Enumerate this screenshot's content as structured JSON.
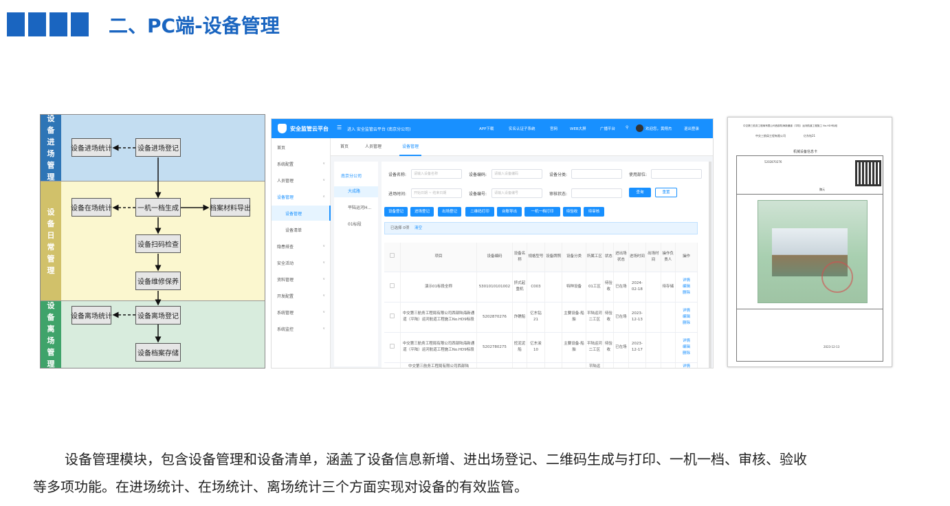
{
  "header": {
    "title": "二、PC端-设备管理",
    "accent": "#1a65c0"
  },
  "flow": {
    "bands": [
      {
        "label": "设备进场管理",
        "color": "#c3ddf1",
        "label_color": "#2e75b6"
      },
      {
        "label": "设备日常管理",
        "color": "#fbf7cf",
        "label_color": "#d1c16a"
      },
      {
        "label": "设备离场管理",
        "color": "#d8ecdd",
        "label_color": "#3fa36a"
      }
    ],
    "boxes": {
      "entry_stats": "设备进场统计",
      "entry_register": "设备进场登记",
      "onsite_stats": "设备在场统计",
      "one_machine": "一机一档生成",
      "archive_export": "档案材料导出",
      "scan_check": "设备扫码检查",
      "maintenance": "设备维修保养",
      "exit_stats": "设备离场统计",
      "exit_register": "设备离场登记",
      "archive_store": "设备档案存储"
    }
  },
  "app": {
    "brand": "安全监管云平台",
    "enter": "进入 安全监管云平台 (南京分公司)",
    "top_links": [
      "APP下载",
      "实名认证子系统",
      "官网",
      "WEB大屏",
      "广播平台"
    ],
    "user": "欢迎您，黄翔杰",
    "logout": "退出登录",
    "sidebar": [
      {
        "label": "首页"
      },
      {
        "label": "系统配置"
      },
      {
        "label": "人员管理"
      },
      {
        "label": "设备管理"
      },
      {
        "label": "设备管理"
      },
      {
        "label": "设备清单"
      },
      {
        "label": "隐患排查"
      },
      {
        "label": "安全活动"
      },
      {
        "label": "资料管理"
      },
      {
        "label": "开发配置"
      },
      {
        "label": "系统管理"
      },
      {
        "label": "系统监控"
      }
    ],
    "tabs": [
      "首页",
      "人员管理",
      "设备管理"
    ],
    "tree": [
      "南京分公司",
      "大成路",
      "平陆运河H...",
      "01标段"
    ],
    "filters": {
      "name_label": "设备名称:",
      "name_ph": "请输入设备名称",
      "code_label": "设备编码:",
      "code_ph": "请输入设备编码",
      "cat_label": "设备分类:",
      "pos_label": "使用部位:",
      "time_label": "进场时间:",
      "time_ph": "开始日期 ~ 结束日期",
      "model_label": "设备编号:",
      "model_ph": "请输入设备编号",
      "audit_label": "审核状态:",
      "search": "查询",
      "reset": "重置"
    },
    "actions": [
      "设备登记",
      "进场登记",
      "出场登记",
      "二维码打印",
      "台账导出",
      "一机一档打印",
      "待验收",
      "待审核"
    ],
    "selection": {
      "text": "已选择 0项",
      "clear": "清空"
    },
    "columns": [
      "项目",
      "设备编码",
      "设备名称",
      "规格型号",
      "设备牌照",
      "设备分类",
      "所属工区",
      "状态",
      "进出场状态",
      "进场时间",
      "出场时间",
      "操作负责人",
      "操作"
    ],
    "rows": [
      {
        "project": "演示01标段全称",
        "code": "5301010101002",
        "name": "挤式起重机",
        "model": "C003",
        "plate": "",
        "cat": "特种设备",
        "area": "01工区",
        "status": "待验收",
        "io": "已在场",
        "in": "2024-02-18",
        "out": "",
        "person": "待存储"
      },
      {
        "project": "中交第三航务工程局有限公司西部陆海新通道（平陆）运河航道工程施工No.HD9标段",
        "code": "5202870276",
        "name": "炸礁船",
        "model": "亿东钻21",
        "plate": "",
        "cat": "主要设备-船舶",
        "area": "平陆运河二工区",
        "status": "待验收",
        "io": "已在场",
        "in": "2023-12-13",
        "out": "",
        "person": ""
      },
      {
        "project": "中交第三航务工程局有限公司西部陆海新通道（平陆）运河航道工程施工No.HD9标段",
        "code": "5202780275",
        "name": "挖泥泥船",
        "model": "亿东浚10",
        "plate": "",
        "cat": "主要设备-船舶",
        "area": "平陆运河二工区",
        "status": "待验收",
        "io": "已在场",
        "in": "2023-12-17",
        "out": "",
        "person": ""
      },
      {
        "project": "中交第三航务工程局有限公司西部陆",
        "code": "",
        "name": "",
        "model": "",
        "plate": "",
        "cat": "",
        "area": "平陆运",
        "status": "",
        "io": "",
        "in": "",
        "out": "",
        "person": ""
      }
    ],
    "ops": [
      "详情",
      "编辑",
      "删除"
    ]
  },
  "doc": {
    "heading": "中交第三航务工程局有限公司西部陆海新通道（平陆）运河航道工程施工 No.HD9标段",
    "title": "机械设备信息卡",
    "code": "5202870276",
    "reg_date": "2023-12-13",
    "owner": "魏元",
    "unit": "中交三航局工程有限公司",
    "vessel": "亿东钻21"
  },
  "description": {
    "line1": "设备管理模块，包含设备管理和设备清单，涵盖了设备信息新增、进出场登记、二维码生成与打印、一机一档、审核、验收",
    "line2": "等多项功能。在进场统计、在场统计、离场统计三个方面实现对设备的有效监管。"
  }
}
